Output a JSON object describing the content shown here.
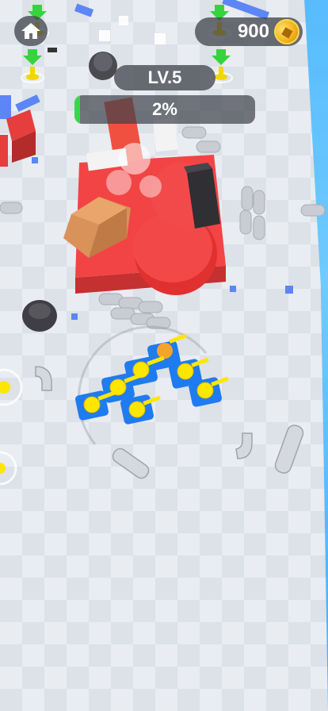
{
  "hud": {
    "home_icon": "home-icon",
    "coins": "900",
    "coin_icon": "coin-icon",
    "level": "LV.5",
    "progress_text": "2%",
    "progress_value": 0.02
  },
  "colors": {
    "accent": "#38d84a",
    "marker_arrow": "#37d33d",
    "marker_pin": "#f2d800",
    "tank_blue": "#1f7bf0",
    "tank_yellow": "#ffe600",
    "debris_red": "#f23b3b"
  }
}
